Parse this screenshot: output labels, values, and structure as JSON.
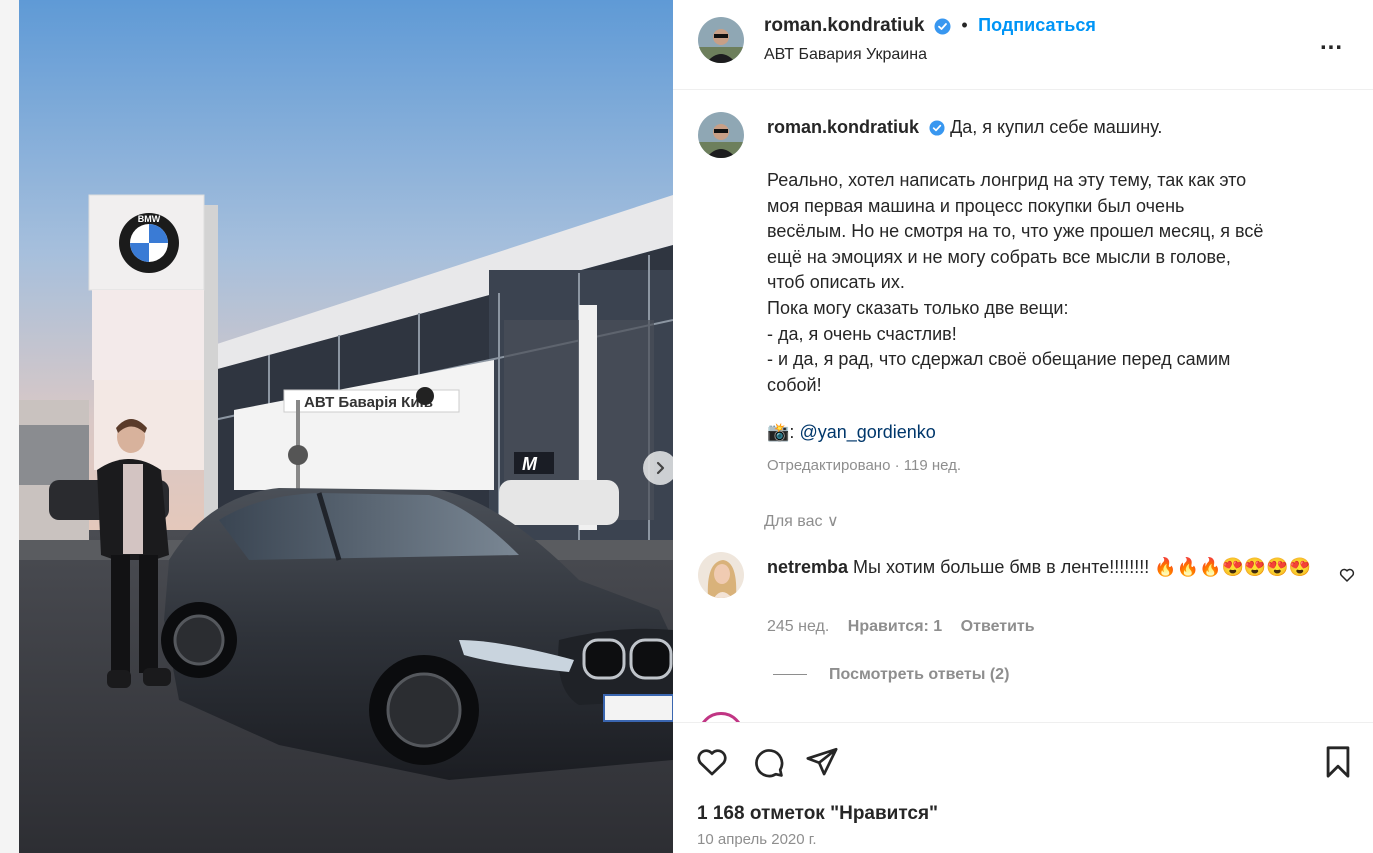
{
  "header": {
    "username": "roman.kondratiuk",
    "separator": "•",
    "follow_label": "Подписаться",
    "location": "АВТ Бавария Украина",
    "more_label": "..."
  },
  "photo": {
    "sign_text": "АВТ Баварія Київ",
    "brand_text": "BMW",
    "m_text": "M"
  },
  "caption": {
    "username": "roman.kondratiuk",
    "first_line": "Да, я купил себе машину.",
    "body": "Реально, хотел написать лонгрид на эту тему, так как это\nмоя первая машина и процесс покупки был очень\nвесёлым. Но не смотря на то, что уже прошел месяц, я всё\nещё на эмоциях и не могу собрать все мысли в голове,\nчтоб описать их.\nПока могу сказать только две вещи:\n- да, я очень счастлив!\n- и да, я рад, что сдержал своё обещание перед самим\nсобой!",
    "credit_emoji": "📸:",
    "credit_mention": "@yan_gordienko",
    "edited": "Отредактировано · 119 нед."
  },
  "for_you": "Для вас ∨",
  "comment": {
    "username": "netremba",
    "text": "Мы хотим больше бмв в ленте!!!!!!!! 🔥🔥🔥😍😍😍😍",
    "age": "245 нед.",
    "likes": "Нравится: 1",
    "reply": "Ответить",
    "view_replies": "Посмотреть ответы (2)"
  },
  "footer": {
    "likes_count": "1 168 отметок \"Нравится\"",
    "date": "10 апрель 2020 г."
  },
  "colors": {
    "accent": "#0095f6",
    "verified": "#3897f0",
    "muted": "#8e8e8e",
    "text": "#262626"
  }
}
